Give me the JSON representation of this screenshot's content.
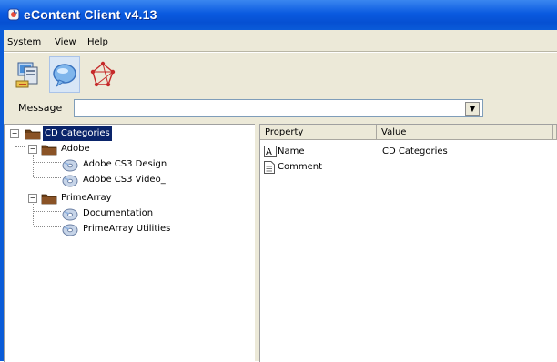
{
  "window": {
    "title": "eContent Client v4.13"
  },
  "menubar": {
    "items": [
      "System",
      "View",
      "Help"
    ]
  },
  "toolbar": {
    "buttons": [
      "computer-icon",
      "chat-bubble-icon",
      "network-icon"
    ],
    "pressed_index": 1
  },
  "message_bar": {
    "label": "Message",
    "value": "",
    "dropdown_glyph": "▼"
  },
  "tree": {
    "root": {
      "label": "CD Categories",
      "selected": true,
      "expanded": true
    },
    "groups": [
      {
        "label": "Adobe",
        "expanded": true,
        "children": [
          "Adobe CS3 Design",
          "Adobe CS3 Video_"
        ]
      },
      {
        "label": "PrimeArray",
        "expanded": true,
        "children": [
          "Documentation",
          "PrimeArray Utilities"
        ]
      }
    ]
  },
  "properties": {
    "columns": [
      "Property",
      "Value"
    ],
    "rows": [
      {
        "name": "Name",
        "value": "CD Categories",
        "icon": "text-field-icon"
      },
      {
        "name": "Comment",
        "value": "",
        "icon": "note-icon"
      }
    ]
  },
  "colors": {
    "titlebar": "#0a5bd8",
    "chrome": "#ece9d8",
    "selection": "#0a246a"
  }
}
